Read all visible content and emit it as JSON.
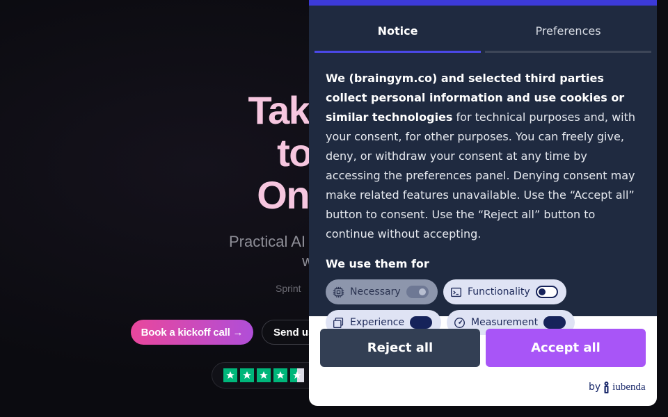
{
  "hero": {
    "title_lines": [
      "Take your",
      "to Buil",
      "One Spri"
    ],
    "subtitle_lines": [
      "Practical AI sprints where team",
      "with work"
    ],
    "note": "Sprint",
    "cta_primary": "Book a kickoff call →",
    "cta_secondary": "Send us",
    "rating_stars": 4.5
  },
  "dialog": {
    "tabs": [
      {
        "label": "Notice",
        "active": true
      },
      {
        "label": "Preferences",
        "active": false
      }
    ],
    "notice_bold": "We (braingym.co) and selected third parties collect personal information and use cookies or similar technologies",
    "notice_rest": " for technical purposes and, with your consent, for other purposes. You can freely give, deny, or withdraw your consent at any time by accessing the preferences panel. Denying consent may make related features unavailable. Use the “Accept all” button to consent. Use the “Reject all” button to continue without accepting.",
    "use_heading": "We use them for",
    "purposes": [
      {
        "label": "Necessary",
        "icon": "chip-icon",
        "enabled": true,
        "locked": true
      },
      {
        "label": "Functionality",
        "icon": "terminal-icon",
        "enabled": false,
        "locked": false
      },
      {
        "label": "Experience",
        "icon": "layers-icon",
        "enabled": false,
        "locked": false
      },
      {
        "label": "Measurement",
        "icon": "gauge-icon",
        "enabled": false,
        "locked": false
      }
    ],
    "reject_label": "Reject all",
    "accept_label": "Accept all",
    "byline_prefix": "by",
    "byline_brand": "iubenda"
  },
  "colors": {
    "accent": "#a855f7",
    "tab_indicator": "#4b48e8",
    "dialog_bg": "#1f2a40",
    "star": "#00b67a",
    "hero_title": "#f6c6df"
  }
}
